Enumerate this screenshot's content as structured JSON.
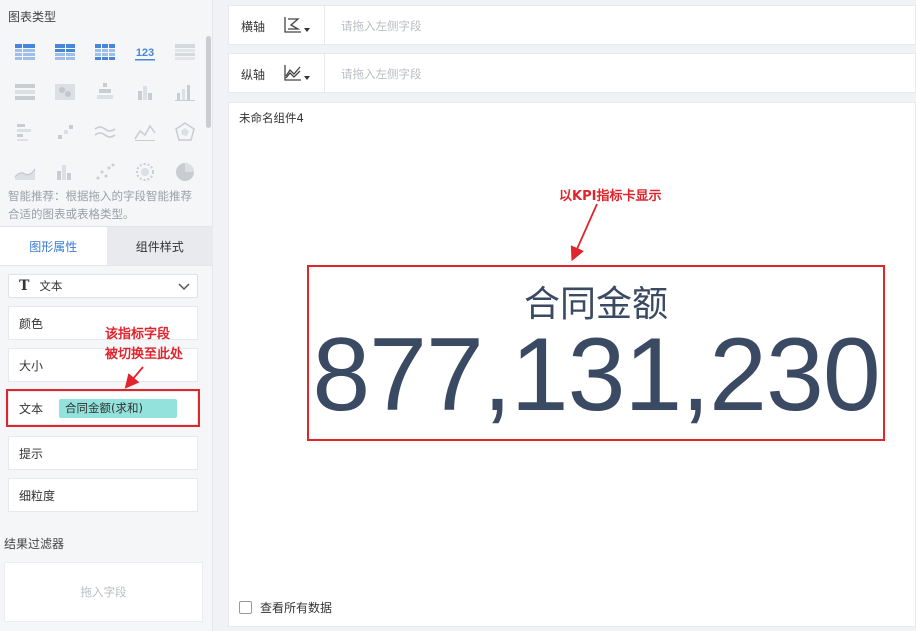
{
  "left_panel": {
    "chart_types_title": "图表类型",
    "chart_icons": [
      [
        "table-icon",
        "cross-table-icon",
        "detail-table-icon",
        "kpi-number-icon",
        "grouped-table-icon"
      ],
      [
        "ranked-table-icon",
        "heatmap-icon",
        "bar-stack-icon",
        "column-icon",
        "column-grouped-icon"
      ],
      [
        "horizontal-bar-icon",
        "scatter-step-icon",
        "multi-line-icon",
        "radar-line-icon",
        "polygon-icon"
      ],
      [
        "area-icon",
        "column-cluster-icon",
        "dot-scatter-icon",
        "bubble-icon",
        "pie-icon"
      ]
    ],
    "kpi_icon_text": "123",
    "hint": "智能推荐：根据拖入的字段智能推荐合适的图表或表格类型。",
    "tabs": {
      "graphic_props": "图形属性",
      "component_style": "组件样式"
    },
    "select": {
      "label": "文本",
      "icon": "T"
    },
    "props": {
      "color": "颜色",
      "size": "大小",
      "text": "文本",
      "text_field": "合同金额(求和)",
      "tooltip": "提示",
      "granularity": "细粒度"
    },
    "annotation": [
      "该指标字段",
      "被切换至此处"
    ],
    "filter_title": "结果过滤器",
    "filter_placeholder": "拖入字段"
  },
  "axes": {
    "x_label": "横轴",
    "x_placeholder": "请拖入左侧字段",
    "y_label": "纵轴",
    "y_placeholder": "请拖入左侧字段"
  },
  "canvas": {
    "component_name": "未命名组件4",
    "annotation": "以KPI指标卡显示",
    "kpi_title": "合同金额",
    "kpi_value": "877,131,230",
    "view_all": "查看所有数据"
  },
  "colors": {
    "accent": "#3a7bd5",
    "annotation_red": "#e0252d",
    "kpi_text": "#3b4a63",
    "pill": "#93e2dc"
  }
}
